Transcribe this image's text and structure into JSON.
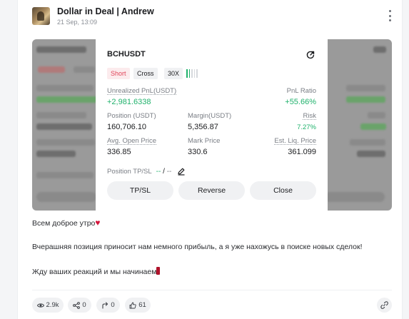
{
  "post": {
    "title": "Dollar in Deal | Andrew",
    "time": "21 Sep, 13:09"
  },
  "position": {
    "symbol": "BCHUSDT",
    "side": "Short",
    "margin_mode": "Cross",
    "leverage": "30X",
    "leverage_bars_active": 2,
    "leverage_bars_total": 5,
    "unrealized_label": "Unrealized PnL(USDT)",
    "unrealized_value": "+2,981.6338",
    "pnl_ratio_label": "PnL Ratio",
    "pnl_ratio_value": "+55.66%",
    "position_label": "Position (USDT)",
    "position_value": "160,706.10",
    "margin_label": "Margin(USDT)",
    "margin_value": "5,356.87",
    "risk_label": "Risk",
    "risk_value": "7.27%",
    "avg_open_label": "Avg. Open Price",
    "avg_open_value": "336.85",
    "mark_label": "Mark Price",
    "mark_value": "330.6",
    "liq_label": "Est. Liq. Price",
    "liq_value": "361.099",
    "tpsl_label": "Position TP/SL",
    "tp_value": "--",
    "slash": "/",
    "sl_value": "--",
    "buttons": {
      "tpsl": "TP/SL",
      "reverse": "Reverse",
      "close": "Close"
    }
  },
  "body": {
    "line1": "Всем доброе утро",
    "line1_emoji": "♥",
    "line2": "Вчерашняя позиция приносит нам немного прибыль, а я уже нахожусь в поиске новых сделок!",
    "line3": "Жду ваших реакций и мы начинаем"
  },
  "stats": {
    "views": "2.9k",
    "shares": "0",
    "reposts": "0",
    "likes": "61"
  },
  "colors": {
    "profit_green": "#20b26c",
    "short_red": "#e0455a"
  }
}
